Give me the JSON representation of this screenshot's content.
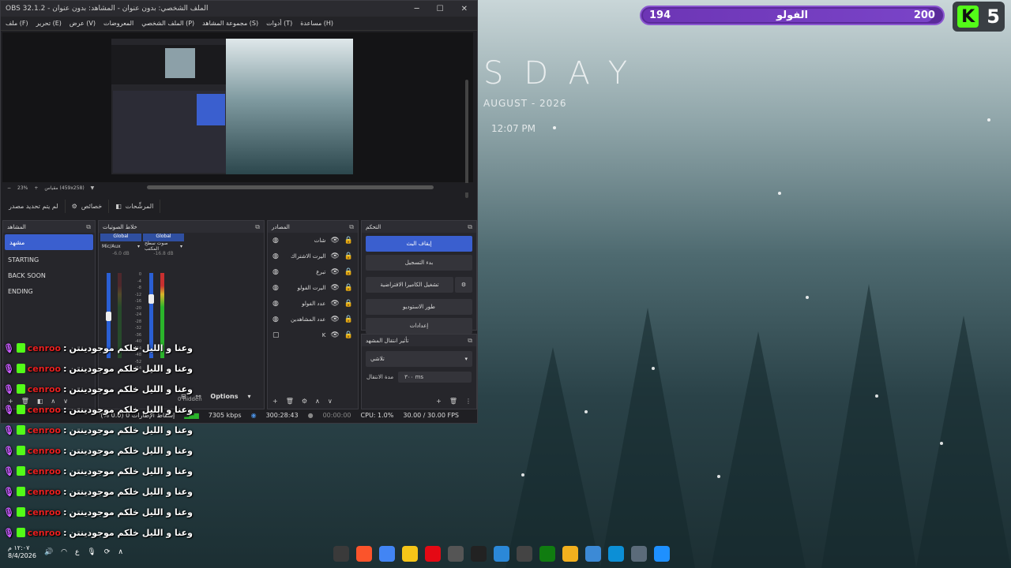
{
  "desktop": {
    "day_text": "SDAY",
    "date_text": "AUGUST - 2026",
    "time_text": "12:07 PM"
  },
  "follow_goal": {
    "current": "194",
    "label": "الفولو",
    "target": "200",
    "progress_fraction": 0.97
  },
  "kick_badge": {
    "count": "5"
  },
  "obs": {
    "title": "OBS 32.1.2 - الملف الشخصي: بدون عنوان - المشاهد: بدون عنوان",
    "menu": [
      "ملف (F)",
      "تحرير (E)",
      "عرض (V)",
      "المعروضات",
      "الملف الشخصي (P)",
      "مجموعة المشاهد (S)",
      "أدوات (T)",
      "مساعدة (H)"
    ],
    "zoom_label": "23%",
    "canvas_info": "مقياس (459x258)",
    "toolbar": {
      "no_source": "لم يتم تحديد مصدر",
      "properties": "خصائص",
      "filters": "المرشِّحات"
    },
    "scenes": {
      "title": "المشاهد",
      "items": [
        "مشهد",
        "STARTING",
        "BACK SOON",
        "ENDING"
      ]
    },
    "mixer": {
      "title": "خلاط الصوتيات",
      "channels": [
        {
          "tag": "Global",
          "name": "Mic/Aux",
          "db": "-6.0 dB",
          "level": 0.55
        },
        {
          "tag": "Global",
          "name": "صوت سطح المكتب",
          "db": "-16.8 dB",
          "level": 0.75
        }
      ],
      "scale": [
        "0",
        "-4",
        "-8",
        "-12",
        "-16",
        "-20",
        "-24",
        "-28",
        "-32",
        "-36",
        "-40",
        "-44",
        "-48",
        "-52",
        "-54"
      ],
      "hidden_label": "0 hidden"
    },
    "sources": {
      "title": "المصادر",
      "items": [
        "شات",
        "اليرت الاشتراك",
        "تبرع",
        "اليرت الفولو",
        "عدد الفولو",
        "عدد المشاهدين",
        "K"
      ]
    },
    "controls": {
      "title": "التحكم",
      "stop_stream": "إيقاف البث",
      "start_record": "بدء التسجيل",
      "virtual_cam": "تشغيل الكاميرا الافتراضية",
      "studio_mode": "طور الاستوديو",
      "settings": "إعدادات"
    },
    "transitions": {
      "title": "تأثير انتقال المشهد",
      "selected": "تلاشي",
      "duration_label": "مدة الانتقال",
      "duration_value": "٣٠٠ ms"
    },
    "options_label": "Options",
    "status": {
      "dropped": "إسقاط الإطارات 0 (0.0 %)",
      "bitrate": "7305 kbps",
      "stream_time": "300:28:43",
      "rec_time": "00:00:00",
      "cpu": "CPU: 1.0%",
      "fps": "30.00 / 30.00 FPS"
    }
  },
  "chat": {
    "username": "cenroo",
    "message": "وعنا و الليل خلكم موجودينتن",
    "lines": 10
  },
  "taskbar": {
    "time": "١٢:٠٧ م",
    "date": "8/4/2026",
    "lang": "ع",
    "icons": [
      "obs-icon",
      "brave-icon",
      "chrome-icon",
      "discord-icon",
      "netflix-icon",
      "app-icon",
      "search-icon",
      "mail-icon",
      "mic-icon",
      "xbox-icon",
      "folder-icon",
      "store-icon",
      "edge-icon",
      "settings-icon",
      "windows-icon"
    ],
    "colors": [
      "#3a3a3a",
      "#fb542b",
      "#4285f4",
      "#f5c518",
      "#e50914",
      "#555555",
      "#222222",
      "#2b88d8",
      "#444444",
      "#107c10",
      "#f2b01e",
      "#3c8ad6",
      "#0c8fd6",
      "#5b6b7a",
      "#1e90ff"
    ]
  }
}
